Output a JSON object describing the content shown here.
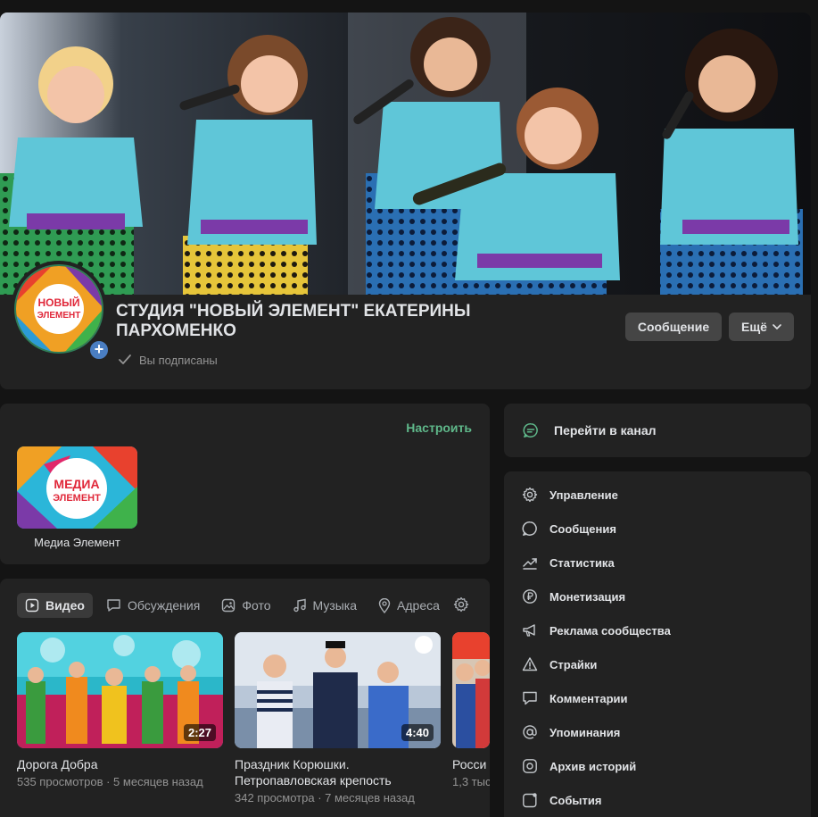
{
  "header": {
    "title": "СТУДИЯ \"НОВЫЙ ЭЛЕМЕНТ\" ЕКАТЕРИНЫ ПАРХОМЕНКО",
    "subscribed_label": "Вы подписаны",
    "message_button": "Сообщение",
    "more_button": "Ещё",
    "avatar_text_line1": "НОВЫЙ",
    "avatar_text_line2": "ЭЛЕМЕНТ"
  },
  "links": {
    "configure_label": "Настроить",
    "items": [
      {
        "label": "Медиа Элемент",
        "logo_line1": "МЕДИА",
        "logo_line2": "ЭЛЕМЕНТ"
      }
    ]
  },
  "content": {
    "tabs": [
      {
        "label": "Видео",
        "icon": "video-icon",
        "active": true
      },
      {
        "label": "Обсуждения",
        "icon": "discussion-icon"
      },
      {
        "label": "Фото",
        "icon": "photo-icon"
      },
      {
        "label": "Музыка",
        "icon": "music-icon"
      },
      {
        "label": "Адреса",
        "icon": "location-icon"
      }
    ],
    "videos": [
      {
        "title": "Дорога Добра",
        "duration": "2:27",
        "meta": "535 просмотров · 5 месяцев назад"
      },
      {
        "title": "Праздник Корюшки. Петропавловская крепость",
        "duration": "4:40",
        "meta": "342 просмотра · 7 месяцев назад"
      },
      {
        "title": "Росси",
        "duration": "",
        "meta": "1,3 тыс"
      }
    ]
  },
  "sidebar": {
    "channel_label": "Перейти в канал",
    "menu": [
      {
        "label": "Управление",
        "icon": "gear-icon"
      },
      {
        "label": "Сообщения",
        "icon": "message-icon"
      },
      {
        "label": "Статистика",
        "icon": "chart-icon"
      },
      {
        "label": "Монетизация",
        "icon": "ruble-icon"
      },
      {
        "label": "Реклама сообщества",
        "icon": "megaphone-icon"
      },
      {
        "label": "Страйки",
        "icon": "warning-icon"
      },
      {
        "label": "Комментарии",
        "icon": "comment-icon"
      },
      {
        "label": "Упоминания",
        "icon": "at-icon"
      },
      {
        "label": "Архив историй",
        "icon": "stories-archive-icon"
      },
      {
        "label": "События",
        "icon": "events-icon"
      }
    ]
  },
  "colors": {
    "background": "#141414",
    "card": "#222222",
    "accent_green": "#5fb88a",
    "button": "#454545",
    "muted_text": "#939393"
  }
}
